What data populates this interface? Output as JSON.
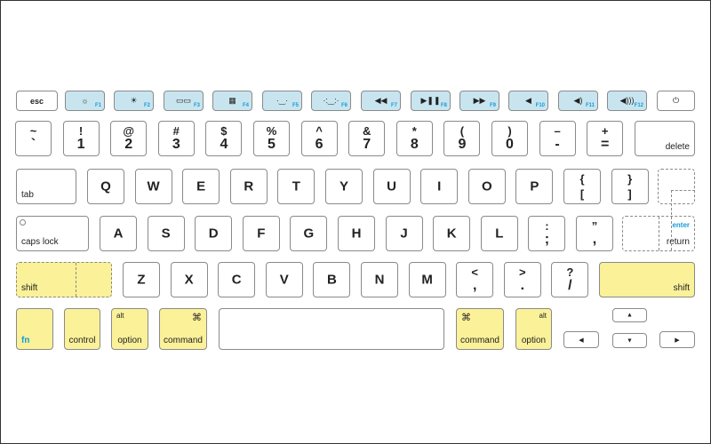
{
  "colors": {
    "function_keys": "#c8e5ef",
    "modifier_keys": "#faf199",
    "fn_label": "#1a9ad6"
  },
  "function_row": [
    {
      "label": "esc"
    },
    {
      "icon": "brightness-down-icon",
      "glyph": "☼",
      "fn": "F1"
    },
    {
      "icon": "brightness-up-icon",
      "glyph": "☀",
      "fn": "F2"
    },
    {
      "icon": "mission-control-icon",
      "glyph": "▭▭",
      "fn": "F3"
    },
    {
      "icon": "launchpad-icon",
      "glyph": "▦",
      "fn": "F4"
    },
    {
      "icon": "keyboard-light-down-icon",
      "glyph": "·‿·",
      "fn": "F5"
    },
    {
      "icon": "keyboard-light-up-icon",
      "glyph": "·:‿:·",
      "fn": "F6"
    },
    {
      "icon": "rewind-icon",
      "glyph": "◀◀",
      "fn": "F7"
    },
    {
      "icon": "play-pause-icon",
      "glyph": "▶❚❚",
      "fn": "F8"
    },
    {
      "icon": "fast-forward-icon",
      "glyph": "▶▶",
      "fn": "F9"
    },
    {
      "icon": "mute-icon",
      "glyph": "◀",
      "fn": "F10"
    },
    {
      "icon": "volume-down-icon",
      "glyph": "◀)",
      "fn": "F11"
    },
    {
      "icon": "volume-up-icon",
      "glyph": "◀)))",
      "fn": "F12"
    },
    {
      "icon": "power-icon",
      "glyph": "⏻"
    }
  ],
  "number_row": [
    {
      "top": "~",
      "bottom": "`"
    },
    {
      "top": "!",
      "bottom": "1"
    },
    {
      "top": "@",
      "bottom": "2"
    },
    {
      "top": "#",
      "bottom": "3"
    },
    {
      "top": "$",
      "bottom": "4"
    },
    {
      "top": "%",
      "bottom": "5"
    },
    {
      "top": "^",
      "bottom": "6"
    },
    {
      "top": "&",
      "bottom": "7"
    },
    {
      "top": "*",
      "bottom": "8"
    },
    {
      "top": "(",
      "bottom": "9"
    },
    {
      "top": ")",
      "bottom": "0"
    },
    {
      "top": "–",
      "bottom": "-"
    },
    {
      "top": "+",
      "bottom": "="
    },
    {
      "label": "delete"
    }
  ],
  "qwerty_row": {
    "tab": "tab",
    "letters": [
      "Q",
      "W",
      "E",
      "R",
      "T",
      "Y",
      "U",
      "I",
      "O",
      "P"
    ],
    "brackets": [
      {
        "top": "{",
        "bottom": "["
      },
      {
        "top": "}",
        "bottom": "]"
      }
    ]
  },
  "home_row": {
    "caps": "caps lock",
    "letters": [
      "A",
      "S",
      "D",
      "F",
      "G",
      "H",
      "J",
      "K",
      "L"
    ],
    "punct": [
      {
        "top": ":",
        "bottom": ";"
      },
      {
        "top": "”",
        "bottom": ","
      }
    ],
    "enter": "enter",
    "return": "return"
  },
  "shift_row": {
    "shift_left": "shift",
    "letters": [
      "Z",
      "X",
      "C",
      "V",
      "B",
      "N",
      "M"
    ],
    "punct": [
      {
        "top": "<",
        "bottom": ","
      },
      {
        "top": ">",
        "bottom": "."
      },
      {
        "top": "?",
        "bottom": "/"
      }
    ],
    "shift_right": "shift"
  },
  "bottom_row": {
    "fn": "fn",
    "control": "control",
    "alt": "alt",
    "option": "option",
    "cmd_symbol": "⌘",
    "command": "command",
    "arrows": {
      "up": "▲",
      "left": "◀",
      "down": "▼",
      "right": "▶"
    }
  }
}
